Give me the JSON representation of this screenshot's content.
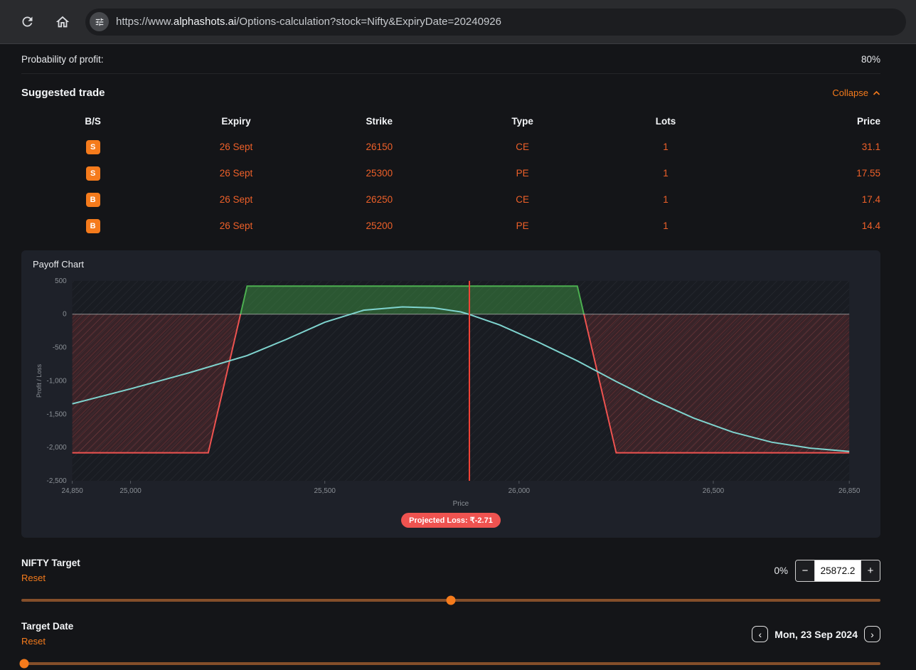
{
  "browser": {
    "url_scheme": "https://www.",
    "url_domain": "alphashots.ai",
    "url_path": "/Options-calculation?stock=Nifty&ExpiryDate=20240926"
  },
  "probability": {
    "label": "Probability of profit:",
    "value": "80%"
  },
  "suggested_trade": {
    "title": "Suggested trade",
    "collapse_label": "Collapse",
    "columns": {
      "bs": "B/S",
      "expiry": "Expiry",
      "strike": "Strike",
      "type": "Type",
      "lots": "Lots",
      "price": "Price"
    },
    "rows": [
      {
        "bs": "S",
        "expiry": "26 Sept",
        "strike": "26150",
        "type": "CE",
        "lots": "1",
        "price": "31.1"
      },
      {
        "bs": "S",
        "expiry": "26 Sept",
        "strike": "25300",
        "type": "PE",
        "lots": "1",
        "price": "17.55"
      },
      {
        "bs": "B",
        "expiry": "26 Sept",
        "strike": "26250",
        "type": "CE",
        "lots": "1",
        "price": "17.4"
      },
      {
        "bs": "B",
        "expiry": "26 Sept",
        "strike": "25200",
        "type": "PE",
        "lots": "1",
        "price": "14.4"
      }
    ]
  },
  "chart_data": {
    "type": "area",
    "title": "Payoff Chart",
    "xlabel": "Price",
    "ylabel": "Profit / Loss",
    "xlim": [
      24850,
      26850
    ],
    "ylim": [
      -2500,
      500
    ],
    "x_ticks": [
      24850,
      25000,
      25500,
      26000,
      26500,
      26850
    ],
    "x_tick_labels": [
      "24,850",
      "25,000",
      "25,500",
      "26,000",
      "26,500",
      "26,850"
    ],
    "y_ticks": [
      500,
      0,
      -500,
      -1000,
      -1500,
      -2000,
      -2500
    ],
    "y_tick_labels": [
      "500",
      "0",
      "-500",
      "-1,000",
      "-1,500",
      "-2,000",
      "-2,500"
    ],
    "marker_x": 25872.2,
    "series": [
      {
        "name": "expiry-payoff",
        "type": "payoff-area",
        "points": [
          [
            24850,
            -2078.75
          ],
          [
            25200,
            -2078.75
          ],
          [
            25300,
            421.25
          ],
          [
            26150,
            421.25
          ],
          [
            26250,
            -2078.75
          ],
          [
            26850,
            -2078.75
          ]
        ]
      },
      {
        "name": "t0-pnl",
        "type": "line",
        "color": "#7fd4cf",
        "points": [
          [
            24850,
            -1345
          ],
          [
            25000,
            -1120
          ],
          [
            25150,
            -880
          ],
          [
            25300,
            -620
          ],
          [
            25400,
            -380
          ],
          [
            25500,
            -120
          ],
          [
            25600,
            60
          ],
          [
            25700,
            110
          ],
          [
            25780,
            95
          ],
          [
            25850,
            35
          ],
          [
            25872,
            -3
          ],
          [
            25950,
            -160
          ],
          [
            26050,
            -420
          ],
          [
            26150,
            -700
          ],
          [
            26250,
            -1010
          ],
          [
            26350,
            -1300
          ],
          [
            26450,
            -1560
          ],
          [
            26550,
            -1770
          ],
          [
            26650,
            -1920
          ],
          [
            26750,
            -2010
          ],
          [
            26850,
            -2060
          ]
        ]
      }
    ],
    "annotation": "Projected Loss: ₹-2.71",
    "legend": "off",
    "grid": "off",
    "colors": {
      "profit_fill": "rgba(67,160,71,0.45)",
      "profit_stroke": "#4caf50",
      "loss_fill": "rgba(239,83,80,0.15)",
      "loss_stroke": "#ef5350",
      "line": "#7fd4cf",
      "marker": "#f44336",
      "zero_line": "#d8d8d8",
      "axis_text": "#8b9096",
      "plot_bg": "#191c22"
    }
  },
  "nifty_target": {
    "label": "NIFTY Target",
    "reset_label": "Reset",
    "percent": "0%",
    "minus_glyph": "−",
    "plus_glyph": "+",
    "value": "25872.2",
    "slider_pct": 50
  },
  "target_date": {
    "label": "Target Date",
    "reset_label": "Reset",
    "prev_glyph": "‹",
    "next_glyph": "›",
    "value": "Mon, 23 Sep 2024",
    "slider_pct": 0.3
  },
  "colors": {
    "accent_orange": "#f57b1c",
    "row_text_orange": "#ee6029",
    "badge_bg": "#f57b1c",
    "loss_badge_bg": "#ef5350",
    "panel_bg": "#1e2129",
    "toolbar_bg": "#2a2b2e"
  }
}
